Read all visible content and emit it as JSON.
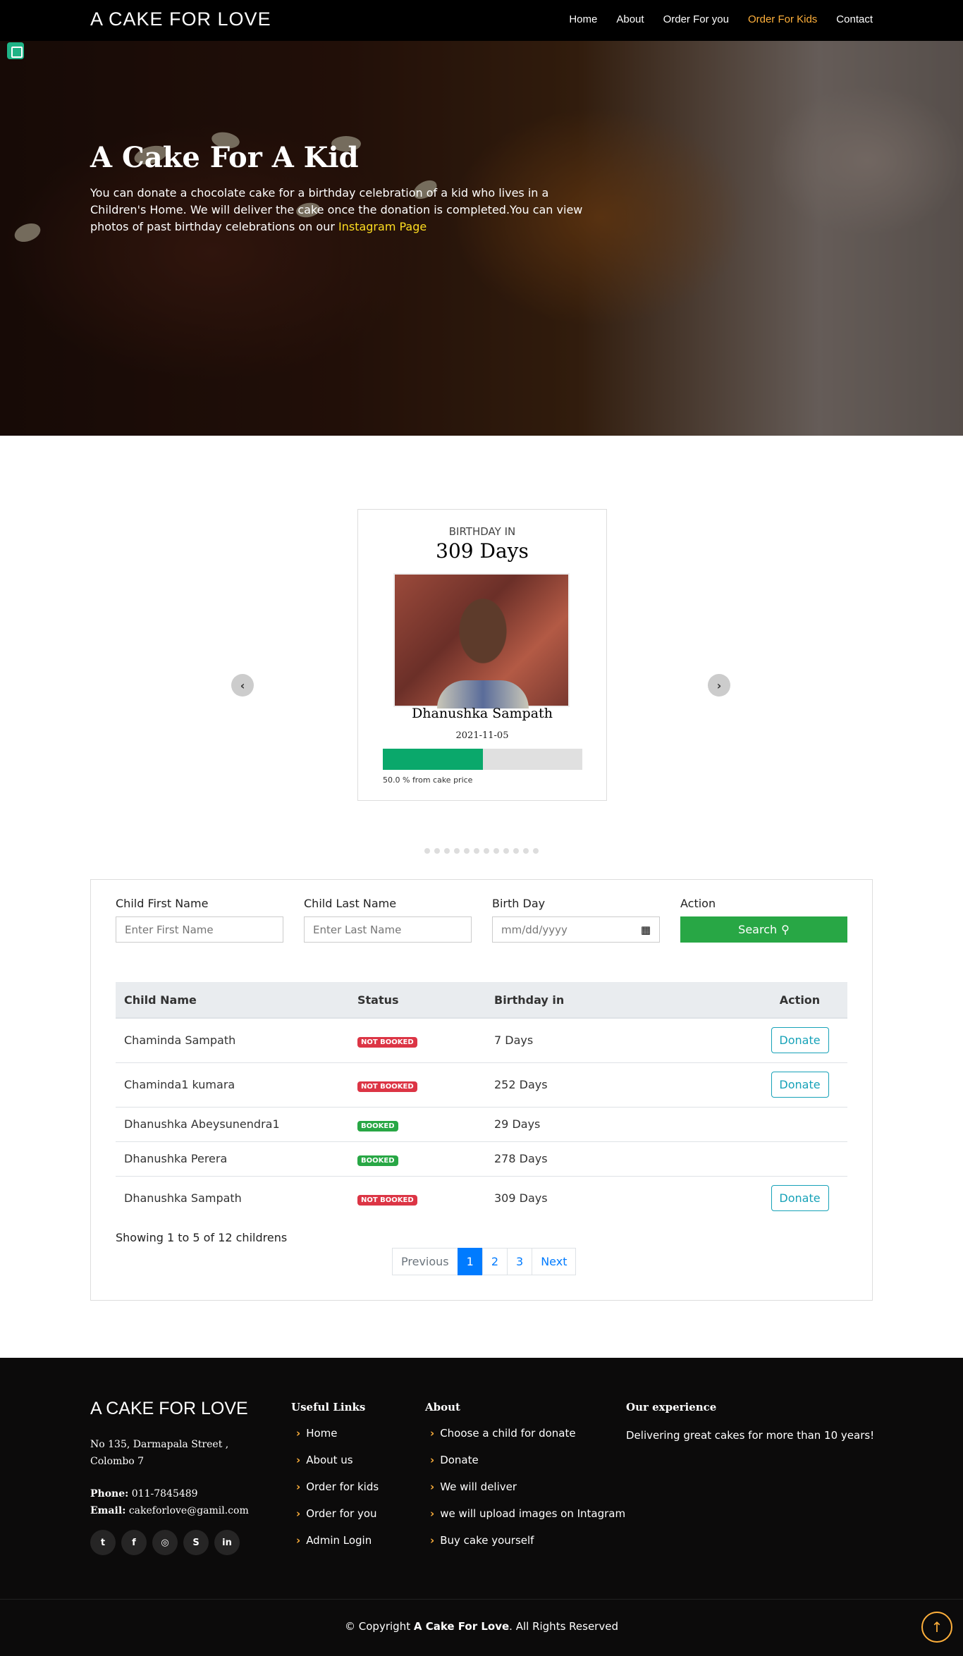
{
  "header": {
    "logo": "A CAKE FOR LOVE",
    "nav": [
      "Home",
      "About",
      "Order For you",
      "Order For Kids",
      "Contact"
    ],
    "active_nav": "Order For Kids"
  },
  "hero": {
    "title": "A Cake For A Kid",
    "text": "You can donate a chocolate cake for a birthday celebration of a kid who lives in a Children's Home. We will deliver the cake once the donation is completed.You can view photos of past birthday celebrations on our ",
    "link": "Instagram Page"
  },
  "carousel": {
    "birthday_in_label": "BIRTHDAY IN",
    "days": "309 Days",
    "name": "Dhanushka Sampath",
    "date": "2021-11-05",
    "progress_fraction": 0.5,
    "progress_label": "50.0 % from cake price",
    "prev_icon": "chevron-left-icon",
    "next_icon": "chevron-right-icon",
    "indicator_count": 12
  },
  "search": {
    "first_name_label": "Child First Name",
    "first_name_placeholder": "Enter First Name",
    "last_name_label": "Child Last Name",
    "last_name_placeholder": "Enter Last Name",
    "birthday_label": "Birth Day",
    "birthday_placeholder": "mm/dd/yyyy",
    "action_label": "Action",
    "search_button": "Search"
  },
  "table": {
    "headers": [
      "Child Name",
      "Status",
      "Birthday in",
      "Action"
    ],
    "rows": [
      {
        "name": "Chaminda Sampath",
        "status": "NOT BOOKED",
        "birthday": "7 Days",
        "action": "Donate"
      },
      {
        "name": "Chaminda1 kumara",
        "status": "NOT BOOKED",
        "birthday": "252 Days",
        "action": "Donate"
      },
      {
        "name": "Dhanushka Abeysunendra1",
        "status": "BOOKED",
        "birthday": "29 Days",
        "action": ""
      },
      {
        "name": "Dhanushka Perera",
        "status": "BOOKED",
        "birthday": "278 Days",
        "action": ""
      },
      {
        "name": "Dhanushka Sampath",
        "status": "NOT BOOKED",
        "birthday": "309 Days",
        "action": "Donate"
      }
    ],
    "showing": "Showing 1 to 5 of 12 childrens",
    "pagination": [
      "Previous",
      "1",
      "2",
      "3",
      "Next"
    ]
  },
  "footer": {
    "logo": "A CAKE FOR LOVE",
    "address_line1": "No 135, Darmapala Street ,",
    "address_line2": "Colombo 7",
    "phone_label": "Phone:",
    "phone": "011-7845489",
    "email_label": "Email:",
    "email": "cakeforlove@gamil.com",
    "useful_links_heading": "Useful Links",
    "useful_links": [
      "Home",
      "About us",
      "Order for kids",
      "Order for you",
      "Admin Login"
    ],
    "about_heading": "About",
    "about_links": [
      "Choose a child for donate",
      "Donate",
      "We will deliver",
      "we will upload images on Intagram",
      "Buy cake yourself"
    ],
    "experience_heading": "Our experience",
    "experience_text": "Delivering great cakes for more than 10 years!",
    "social_icons": [
      "twitter-icon",
      "facebook-icon",
      "instagram-icon",
      "skype-icon",
      "linkedin-icon"
    ],
    "copyright_prefix": "© Copyright ",
    "copyright_brand": "A Cake For Love",
    "copyright_suffix": ". All Rights Reserved"
  },
  "colors": {
    "accent": "#ffb03b",
    "progress": "#0aa86b",
    "booked": "#28a745",
    "not_booked": "#dc3545",
    "primary": "#007bff"
  }
}
